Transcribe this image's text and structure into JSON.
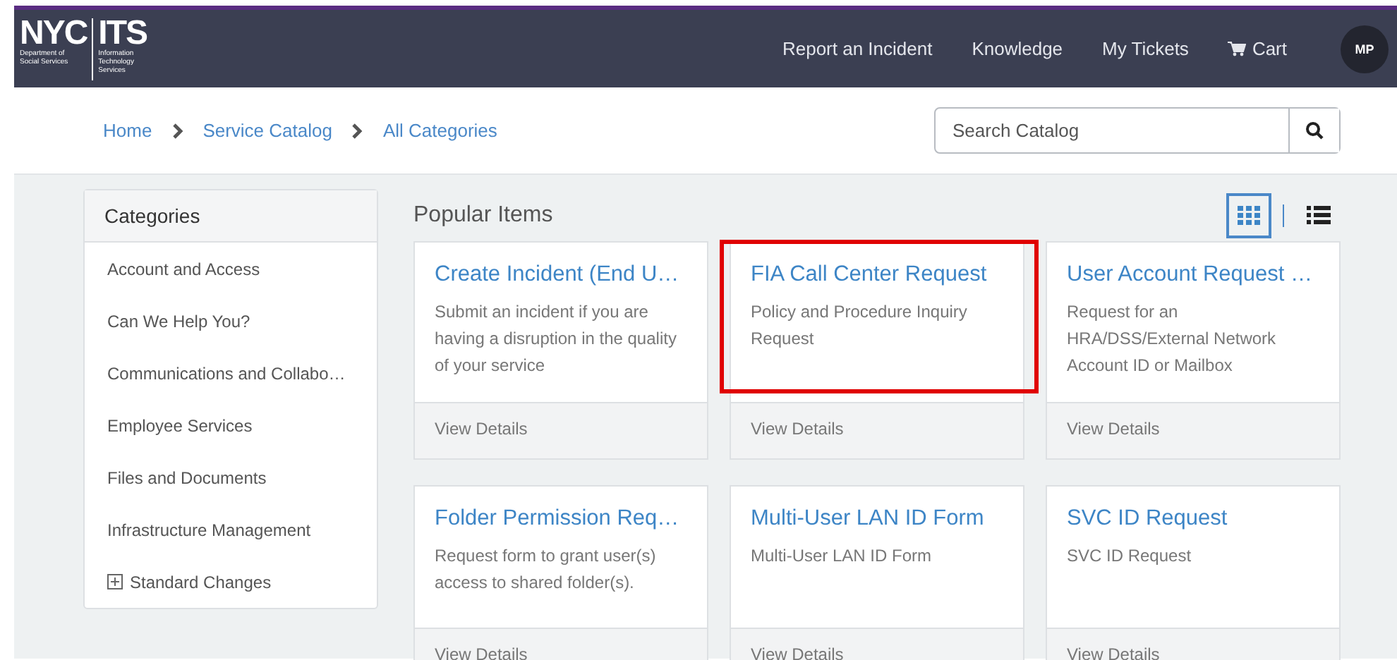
{
  "header": {
    "logo": {
      "mark": "NYC",
      "sub": "Department of Social Services",
      "app": "ITS",
      "app_sub": "Information Technology Services"
    },
    "nav": [
      {
        "label": "Report an Incident",
        "kind": "link"
      },
      {
        "label": "Knowledge",
        "kind": "link"
      },
      {
        "label": "My Tickets",
        "kind": "link"
      },
      {
        "label": "Cart",
        "kind": "cart"
      }
    ],
    "avatar": "MP"
  },
  "breadcrumbs": [
    "Home",
    "Service Catalog",
    "All Categories"
  ],
  "search": {
    "placeholder": "Search Catalog"
  },
  "categories": {
    "title": "Categories",
    "items": [
      {
        "label": "Account and Access",
        "expandable": false
      },
      {
        "label": "Can We Help You?",
        "expandable": false
      },
      {
        "label": "Communications and Collabo…",
        "expandable": false
      },
      {
        "label": "Employee Services",
        "expandable": false
      },
      {
        "label": "Files and Documents",
        "expandable": false
      },
      {
        "label": "Infrastructure Management",
        "expandable": false
      },
      {
        "label": "Standard Changes",
        "expandable": true
      }
    ]
  },
  "popular": {
    "title": "Popular Items",
    "views": [
      {
        "kind": "grid",
        "selected": true
      },
      {
        "kind": "list",
        "selected": false
      }
    ],
    "items": [
      {
        "title": "Create Incident (End U…",
        "description": "Submit an incident if you are having a disruption in the quality of your service",
        "action": "View Details",
        "highlighted": false
      },
      {
        "title": "FIA Call Center Request",
        "description": "Policy and Procedure Inquiry Request",
        "action": "View Details",
        "highlighted": true
      },
      {
        "title": "User Account Request …",
        "description": "Request for an HRA/DSS/External Network Account ID or Mailbox",
        "action": "View Details",
        "highlighted": false
      },
      {
        "title": "Folder Permission Req…",
        "description": "Request form to grant user(s) access to shared folder(s).",
        "action": "View Details",
        "highlighted": false
      },
      {
        "title": "Multi-User LAN ID Form",
        "description": "Multi-User LAN ID Form",
        "action": "View Details",
        "highlighted": false
      },
      {
        "title": "SVC ID Request",
        "description": "SVC ID Request",
        "action": "View Details",
        "highlighted": false
      }
    ]
  }
}
